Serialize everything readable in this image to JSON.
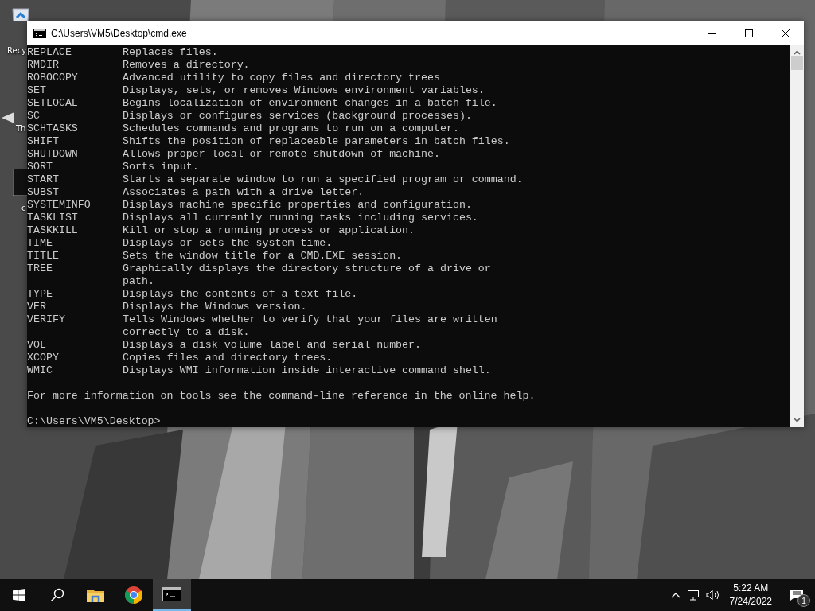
{
  "desktop": {
    "icons": [
      {
        "kind": "recycle",
        "label": "Recy"
      },
      {
        "kind": "shortcut",
        "label": "Th"
      },
      {
        "kind": "cmd",
        "label": "c"
      }
    ]
  },
  "window": {
    "title": "C:\\Users\\VM5\\Desktop\\cmd.exe",
    "lines": [
      {
        "kind": "entry",
        "command": "REPLACE",
        "description": "Replaces files."
      },
      {
        "kind": "entry",
        "command": "RMDIR",
        "description": "Removes a directory."
      },
      {
        "kind": "entry",
        "command": "ROBOCOPY",
        "description": "Advanced utility to copy files and directory trees"
      },
      {
        "kind": "entry",
        "command": "SET",
        "description": "Displays, sets, or removes Windows environment variables."
      },
      {
        "kind": "entry",
        "command": "SETLOCAL",
        "description": "Begins localization of environment changes in a batch file."
      },
      {
        "kind": "entry",
        "command": "SC",
        "description": "Displays or configures services (background processes)."
      },
      {
        "kind": "entry",
        "command": "SCHTASKS",
        "description": "Schedules commands and programs to run on a computer."
      },
      {
        "kind": "entry",
        "command": "SHIFT",
        "description": "Shifts the position of replaceable parameters in batch files."
      },
      {
        "kind": "entry",
        "command": "SHUTDOWN",
        "description": "Allows proper local or remote shutdown of machine."
      },
      {
        "kind": "entry",
        "command": "SORT",
        "description": "Sorts input."
      },
      {
        "kind": "entry",
        "command": "START",
        "description": "Starts a separate window to run a specified program or command."
      },
      {
        "kind": "entry",
        "command": "SUBST",
        "description": "Associates a path with a drive letter."
      },
      {
        "kind": "entry",
        "command": "SYSTEMINFO",
        "description": "Displays machine specific properties and configuration."
      },
      {
        "kind": "entry",
        "command": "TASKLIST",
        "description": "Displays all currently running tasks including services."
      },
      {
        "kind": "entry",
        "command": "TASKKILL",
        "description": "Kill or stop a running process or application."
      },
      {
        "kind": "entry",
        "command": "TIME",
        "description": "Displays or sets the system time."
      },
      {
        "kind": "entry",
        "command": "TITLE",
        "description": "Sets the window title for a CMD.EXE session."
      },
      {
        "kind": "entry",
        "command": "TREE",
        "description": "Graphically displays the directory structure of a drive or"
      },
      {
        "kind": "continuation",
        "text": "path."
      },
      {
        "kind": "entry",
        "command": "TYPE",
        "description": "Displays the contents of a text file."
      },
      {
        "kind": "entry",
        "command": "VER",
        "description": "Displays the Windows version."
      },
      {
        "kind": "entry",
        "command": "VERIFY",
        "description": "Tells Windows whether to verify that your files are written"
      },
      {
        "kind": "continuation",
        "text": "correctly to a disk."
      },
      {
        "kind": "entry",
        "command": "VOL",
        "description": "Displays a disk volume label and serial number."
      },
      {
        "kind": "entry",
        "command": "XCOPY",
        "description": "Copies files and directory trees."
      },
      {
        "kind": "entry",
        "command": "WMIC",
        "description": "Displays WMI information inside interactive command shell."
      },
      {
        "kind": "blank"
      },
      {
        "kind": "text",
        "text": "For more information on tools see the command-line reference in the online help."
      },
      {
        "kind": "blank"
      },
      {
        "kind": "prompt",
        "text": "C:\\Users\\VM5\\Desktop>"
      }
    ]
  },
  "taskbar": {
    "apps": [
      {
        "kind": "start",
        "selected": false
      },
      {
        "kind": "search",
        "selected": false
      },
      {
        "kind": "explorer",
        "selected": false
      },
      {
        "kind": "chrome",
        "selected": false
      },
      {
        "kind": "console",
        "selected": true
      }
    ],
    "time": "5:22 AM",
    "date": "7/24/2022",
    "notification_count": "1"
  }
}
